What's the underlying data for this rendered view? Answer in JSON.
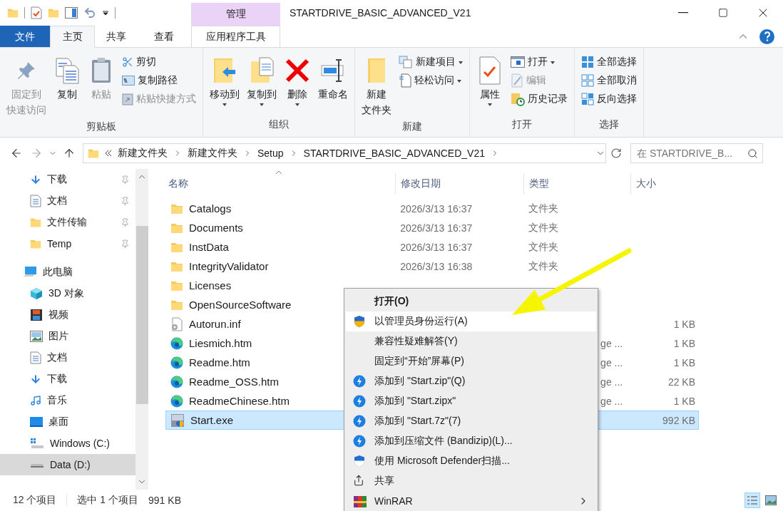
{
  "window": {
    "title": "STARTDRIVE_BASIC_ADVANCED_V21",
    "context_header": "管理"
  },
  "tabs": [
    {
      "label": "文件",
      "kind": "file",
      "selected": false
    },
    {
      "label": "主页",
      "kind": "tab",
      "selected": true
    },
    {
      "label": "共享",
      "kind": "tab",
      "selected": false
    },
    {
      "label": "查看",
      "kind": "tab",
      "selected": false
    },
    {
      "label": "应用程序工具",
      "kind": "context",
      "selected": false
    }
  ],
  "ribbon": {
    "groups": [
      {
        "label": "剪贴板",
        "items": [
          {
            "kind": "large",
            "lines": [
              "固定到",
              "快速访问"
            ],
            "disabled": true,
            "dropdown": false
          },
          {
            "kind": "large",
            "lines": [
              "复制"
            ],
            "disabled": false,
            "dropdown": false
          },
          {
            "kind": "large",
            "lines": [
              "粘贴"
            ],
            "disabled": true,
            "dropdown": false
          },
          {
            "kind": "stack",
            "items": [
              {
                "label": "剪切",
                "disabled": false,
                "dropdown": false
              },
              {
                "label": "复制路径",
                "disabled": false,
                "dropdown": false
              },
              {
                "label": "粘贴快捷方式",
                "disabled": true,
                "dropdown": false
              }
            ]
          }
        ]
      },
      {
        "label": "组织",
        "items": [
          {
            "kind": "large",
            "lines": [
              "移动到"
            ],
            "disabled": false,
            "dropdown": true
          },
          {
            "kind": "large",
            "lines": [
              "复制到"
            ],
            "disabled": false,
            "dropdown": true
          },
          {
            "kind": "large",
            "lines": [
              "删除"
            ],
            "disabled": false,
            "dropdown": true
          },
          {
            "kind": "large",
            "lines": [
              "重命名"
            ],
            "disabled": false,
            "dropdown": false
          }
        ]
      },
      {
        "label": "新建",
        "items": [
          {
            "kind": "large",
            "lines": [
              "新建",
              "文件夹"
            ],
            "disabled": false,
            "dropdown": false
          },
          {
            "kind": "stack",
            "items": [
              {
                "label": "新建项目",
                "disabled": false,
                "dropdown": true
              },
              {
                "label": "轻松访问",
                "disabled": false,
                "dropdown": true
              }
            ]
          }
        ]
      },
      {
        "label": "打开",
        "items": [
          {
            "kind": "large",
            "lines": [
              "属性"
            ],
            "disabled": false,
            "dropdown": true
          },
          {
            "kind": "stack",
            "items": [
              {
                "label": "打开",
                "disabled": false,
                "dropdown": true
              },
              {
                "label": "编辑",
                "disabled": true,
                "dropdown": false
              },
              {
                "label": "历史记录",
                "disabled": false,
                "dropdown": false
              }
            ]
          }
        ]
      },
      {
        "label": "选择",
        "items": [
          {
            "kind": "stack",
            "items": [
              {
                "label": "全部选择",
                "disabled": false,
                "dropdown": false
              },
              {
                "label": "全部取消",
                "disabled": false,
                "dropdown": false
              },
              {
                "label": "反向选择",
                "disabled": false,
                "dropdown": false
              }
            ]
          }
        ]
      }
    ]
  },
  "address": {
    "crumbs": [
      "新建文件夹",
      "新建文件夹",
      "Setup",
      "STARTDRIVE_BASIC_ADVANCED_V21"
    ]
  },
  "search": {
    "placeholder": "在 STARTDRIVE_B..."
  },
  "nav": {
    "quick_items": [
      {
        "label": "下载",
        "pinned": true
      },
      {
        "label": "文档",
        "pinned": true
      },
      {
        "label": "文件传输",
        "pinned": true
      },
      {
        "label": "Temp",
        "pinned": true
      }
    ],
    "this_pc": {
      "label": "此电脑",
      "children": [
        {
          "label": "3D 对象",
          "selected": false
        },
        {
          "label": "视频",
          "selected": false
        },
        {
          "label": "图片",
          "selected": false
        },
        {
          "label": "文档",
          "selected": false
        },
        {
          "label": "下载",
          "selected": false
        },
        {
          "label": "音乐",
          "selected": false
        },
        {
          "label": "桌面",
          "selected": false
        },
        {
          "label": "Windows (C:)",
          "selected": false
        },
        {
          "label": "Data (D:)",
          "selected": true
        }
      ]
    }
  },
  "columns": [
    "名称",
    "修改日期",
    "类型",
    "大小"
  ],
  "files": [
    {
      "name": "Catalogs",
      "date": "2026/3/13 16:37",
      "type": "文件夹",
      "selected": false
    },
    {
      "name": "Documents",
      "date": "2026/3/13 16:37",
      "type": "文件夹",
      "selected": false
    },
    {
      "name": "InstData",
      "date": "2026/3/13 16:37",
      "type": "文件夹",
      "selected": false
    },
    {
      "name": "IntegrityValidator",
      "date": "2026/3/13 16:38",
      "type": "文件夹",
      "selected": false
    },
    {
      "name": "Licenses",
      "selected": false
    },
    {
      "name": "OpenSourceSoftware",
      "selected": false
    },
    {
      "name": "Autorun.inf",
      "size": "1 KB",
      "selected": false
    },
    {
      "name": "Liesmich.htm",
      "type": "ge ...",
      "type_cut": true,
      "size": "1 KB",
      "selected": false
    },
    {
      "name": "Readme.htm",
      "type": "ge ...",
      "type_cut": true,
      "size": "1 KB",
      "selected": false
    },
    {
      "name": "Readme_OSS.htm",
      "type": "ge ...",
      "type_cut": true,
      "size": "22 KB",
      "selected": false
    },
    {
      "name": "ReadmeChinese.htm",
      "type": "ge ...",
      "type_cut": true,
      "size": "1 KB",
      "selected": false
    },
    {
      "name": "Start.exe",
      "size": "992 KB",
      "selected": true
    }
  ],
  "context_menu": {
    "items": [
      {
        "label": "打开(O)",
        "kind": "default",
        "selected": false
      },
      {
        "label": "以管理员身份运行(A)",
        "kind": "item",
        "selected": true
      },
      {
        "label": "兼容性疑难解答(Y)",
        "kind": "item",
        "selected": false
      },
      {
        "label": "固定到“开始”屏幕(P)",
        "kind": "item",
        "selected": false
      },
      {
        "label": "添加到 \"Start.zip\"(Q)",
        "kind": "item",
        "selected": false
      },
      {
        "label": "添加到 \"Start.zipx\"",
        "kind": "item",
        "selected": false
      },
      {
        "label": "添加到 \"Start.7z\"(7)",
        "kind": "item",
        "selected": false
      },
      {
        "label": "添加到压缩文件 (Bandizip)(L)...",
        "kind": "item",
        "selected": false
      },
      {
        "label": "使用 Microsoft Defender扫描...",
        "kind": "item",
        "selected": false
      },
      {
        "label": "共享",
        "kind": "item",
        "selected": false
      },
      {
        "label": "WinRAR",
        "kind": "submenu",
        "selected": false
      }
    ]
  },
  "status_bar": {
    "count": "12 个项目",
    "selection": "选中 1 个项目",
    "size": "991 KB",
    "views": [
      {
        "selected": true
      },
      {
        "selected": false
      }
    ]
  }
}
